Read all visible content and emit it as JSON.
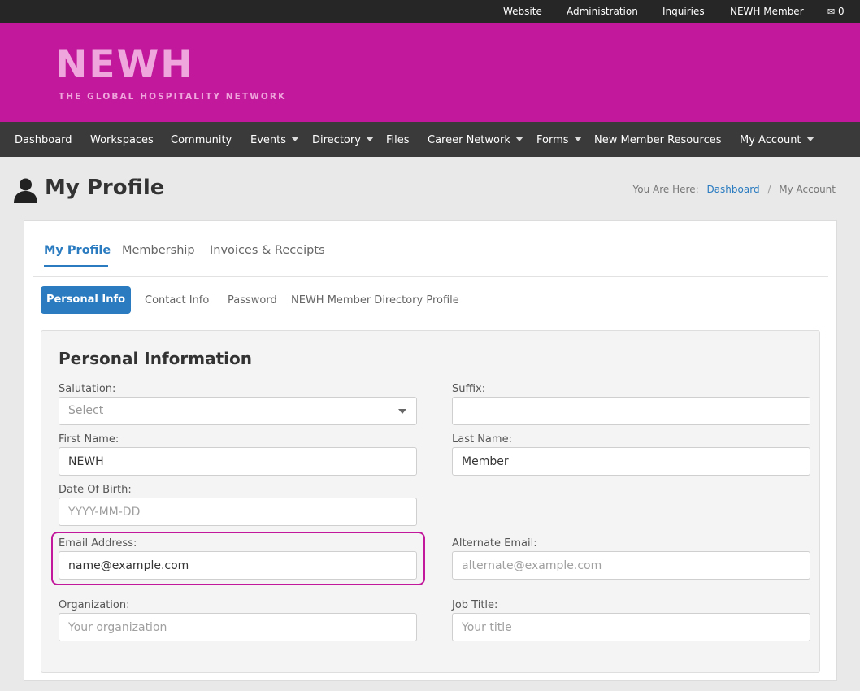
{
  "topbar": {
    "links": [
      "Website",
      "Administration",
      "Inquiries",
      "NEWH Member"
    ],
    "mail_icon": "envelope-icon",
    "mail_count": "0"
  },
  "brand": {
    "title": "NEWH",
    "subtitle": "THE GLOBAL HOSPITALITY NETWORK",
    "colors": {
      "header_bg": "#c2199c",
      "logo_text": "#efa6dc"
    }
  },
  "nav": {
    "items": [
      {
        "label": "Dashboard"
      },
      {
        "label": "Workspaces"
      },
      {
        "label": "Community"
      },
      {
        "label": "Events",
        "dropdown": true
      },
      {
        "label": "Directory",
        "dropdown": true
      },
      {
        "label": "Files"
      },
      {
        "label": "Career Network",
        "dropdown": true
      },
      {
        "label": "Forms",
        "dropdown": true
      },
      {
        "label": "New Member Resources"
      },
      {
        "label": "My Account",
        "dropdown": true
      }
    ]
  },
  "page": {
    "icon": "person-icon",
    "title": "My Profile",
    "breadcrumb": {
      "prefix": "You Are Here:",
      "link": "Dashboard",
      "separator": "/",
      "current": "My Account"
    }
  },
  "tabs": [
    "My Profile",
    "Membership",
    "Invoices & Receipts"
  ],
  "subtabs": [
    "Personal Info",
    "Contact Info",
    "Password",
    "NEWH Member Directory Profile"
  ],
  "form": {
    "title": "Personal Information",
    "salutation": {
      "label": "Salutation:",
      "value": "Select"
    },
    "suffix": {
      "label": "Suffix:",
      "value": ""
    },
    "first_name": {
      "label": "First Name:",
      "value": "NEWH"
    },
    "last_name": {
      "label": "Last Name:",
      "value": "Member"
    },
    "dob": {
      "label": "Date Of Birth:",
      "placeholder": "YYYY-MM-DD"
    },
    "email": {
      "label": "Email Address:",
      "value": "name@example.com"
    },
    "alt_email": {
      "label": "Alternate Email:",
      "placeholder": "alternate@example.com"
    },
    "organization": {
      "label": "Organization:",
      "placeholder": "Your organization"
    },
    "job_title": {
      "label": "Job Title:",
      "placeholder": "Your title"
    }
  },
  "colors": {
    "accent": "#2a7bc0",
    "highlight": "#c2199c"
  }
}
